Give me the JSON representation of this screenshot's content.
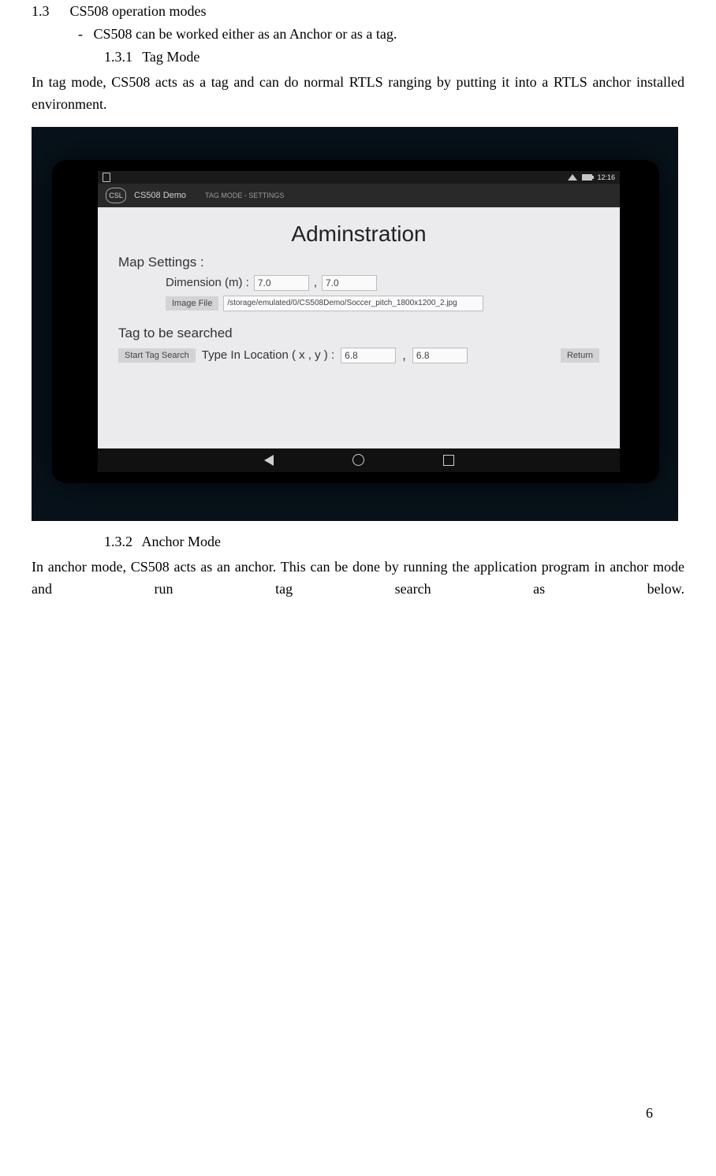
{
  "headings": {
    "sec_num": "1.3",
    "sec_title": "CS508 operation modes",
    "bullet": "CS508 can be worked either as an Anchor or as a tag.",
    "sub1_num": "1.3.1",
    "sub1_title": "Tag Mode",
    "sub2_num": "1.3.2",
    "sub2_title": "Anchor Mode"
  },
  "para1": "In tag mode, CS508 acts as a tag and can do normal RTLS ranging by putting it into a RTLS anchor installed environment.",
  "para2": "In anchor mode, CS508 acts as an anchor. This can be done by running the application program in anchor mode and run tag search as below.",
  "page_number": "6",
  "screenshot": {
    "status": {
      "time": "12:16"
    },
    "appbar": {
      "logo_text": "CSL",
      "title": "CS508 Demo",
      "subtitle": "TAG MODE - SETTINGS"
    },
    "admin_title": "Adminstration",
    "labels": {
      "map_settings": "Map Settings :",
      "dimension": "Dimension (m) :",
      "comma": ",",
      "tag_search": "Tag to be searched",
      "type_loc": "Type In Location ( x , y ) :"
    },
    "values": {
      "dim_x": "7.0",
      "dim_y": "7.0",
      "image_path": "/storage/emulated/0/CS508Demo/Soccer_pitch_1800x1200_2.jpg",
      "loc_x": "6.8",
      "loc_y": "6.8"
    },
    "buttons": {
      "image_file": "Image File",
      "start_tag": "Start Tag Search",
      "return": "Return"
    }
  }
}
